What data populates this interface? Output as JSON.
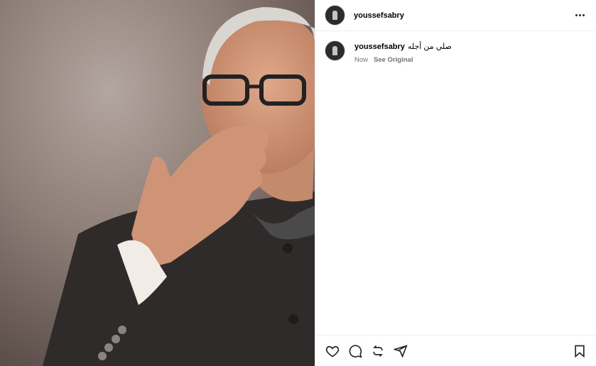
{
  "post": {
    "username": "youssefsabry",
    "more_icon": "more-horizontal-icon"
  },
  "caption": {
    "username": "youssefsabry",
    "text": "صلي من أجله",
    "time": "Now",
    "see_original": "See Original"
  },
  "actions": {
    "icons": [
      "heart-icon",
      "comment-icon",
      "repost-icon",
      "share-icon",
      "bookmark-icon"
    ]
  },
  "media": {
    "description_icon": "post-photo"
  }
}
